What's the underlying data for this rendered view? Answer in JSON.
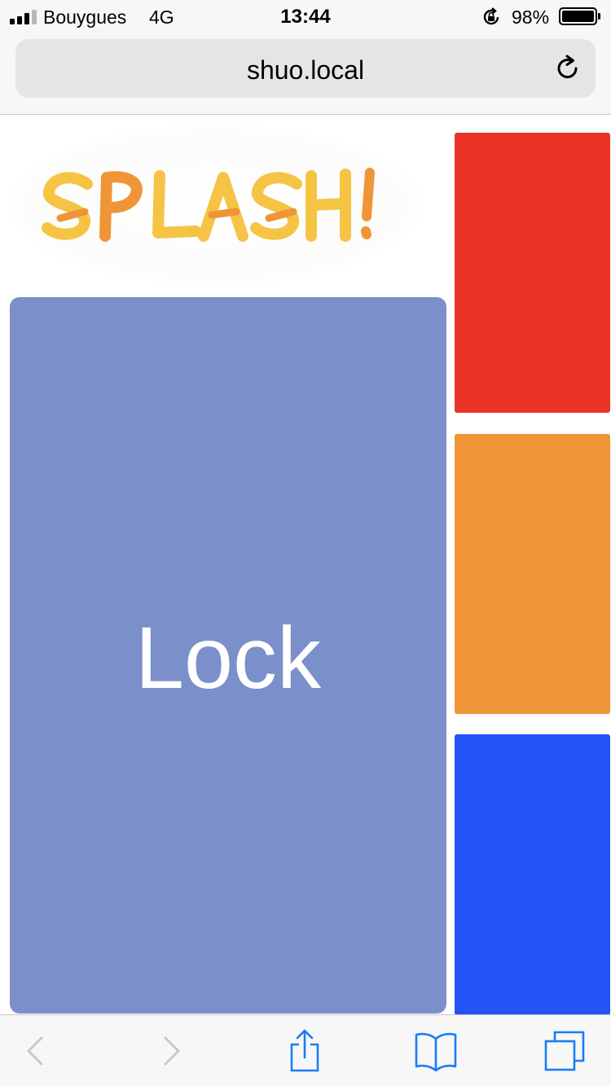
{
  "status_bar": {
    "carrier": "Bouygues",
    "network": "4G",
    "time": "13:44",
    "battery_percent": "98%"
  },
  "url_bar": {
    "url": "shuo.local"
  },
  "logo": {
    "text": "SPLASH!"
  },
  "tiles": {
    "main": {
      "label": "Lock",
      "color": "#7b8fca"
    },
    "side": [
      {
        "color": "#eb3425"
      },
      {
        "color": "#f09537"
      },
      {
        "color": "#2352f5"
      }
    ]
  },
  "toolbar": {
    "icons": [
      "back-icon",
      "forward-icon",
      "share-icon",
      "bookmarks-icon",
      "tabs-icon"
    ],
    "accent": "#1a7cf5"
  }
}
